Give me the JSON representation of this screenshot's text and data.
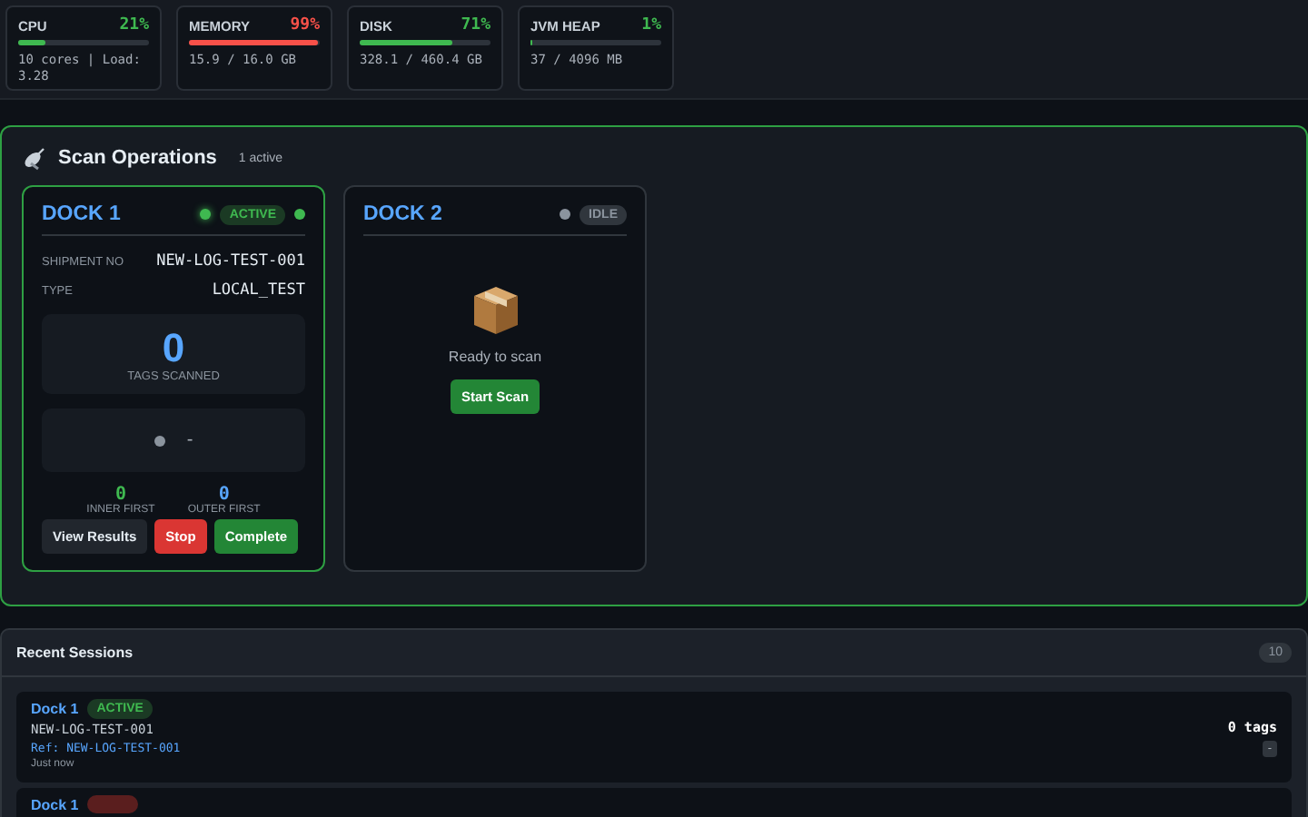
{
  "metrics": [
    {
      "label": "CPU",
      "value": "21%",
      "level": 0.21,
      "color": "#3fb950",
      "detail": "10 cores | Load: 3.28"
    },
    {
      "label": "MEMORY",
      "value": "99%",
      "level": 0.99,
      "color": "#f85149",
      "detail": "15.9 / 16.0 GB"
    },
    {
      "label": "DISK",
      "value": "71%",
      "level": 0.71,
      "color": "#3fb950",
      "detail": "328.1 / 460.4 GB"
    },
    {
      "label": "JVM HEAP",
      "value": "1%",
      "level": 0.01,
      "color": "#3fb950",
      "detail": "37 / 4096 MB"
    }
  ],
  "scan_operations": {
    "title": "Scan Operations",
    "active_count": "1 active",
    "docks": [
      {
        "name": "DOCK 1",
        "kind": "active",
        "status_label": "ACTIVE",
        "fields": [
          {
            "label": "SHIPMENT NO",
            "value": "NEW-LOG-TEST-001"
          },
          {
            "label": "TYPE",
            "value": "LOCAL_TEST"
          }
        ],
        "count": "0",
        "count_label": "TAGS SCANNED",
        "last_tag": "-",
        "stats": [
          {
            "value": "0",
            "label": "INNER FIRST",
            "color": "#3fb950"
          },
          {
            "value": "0",
            "label": "OUTER FIRST",
            "color": "#58a6ff"
          }
        ],
        "actions": [
          {
            "label": "View Results",
            "kind": "neutral"
          },
          {
            "label": "Stop",
            "kind": "danger"
          },
          {
            "label": "Complete",
            "kind": "success"
          }
        ]
      },
      {
        "name": "DOCK 2",
        "kind": "idle",
        "status_label": "IDLE",
        "message": "Ready to scan",
        "actions": [
          {
            "label": "Start Scan",
            "kind": "success"
          }
        ]
      }
    ]
  },
  "recent_sessions": {
    "title": "Recent Sessions",
    "count": "10",
    "items": [
      {
        "dock": "Dock 1",
        "kind": "active",
        "status_label": "ACTIVE",
        "shipment": "NEW-LOG-TEST-001",
        "ref": "Ref: NEW-LOG-TEST-001",
        "time": "Just now",
        "tags": "0 tags",
        "extra": "-"
      },
      {
        "dock": "Dock 1",
        "kind": "error"
      }
    ]
  }
}
